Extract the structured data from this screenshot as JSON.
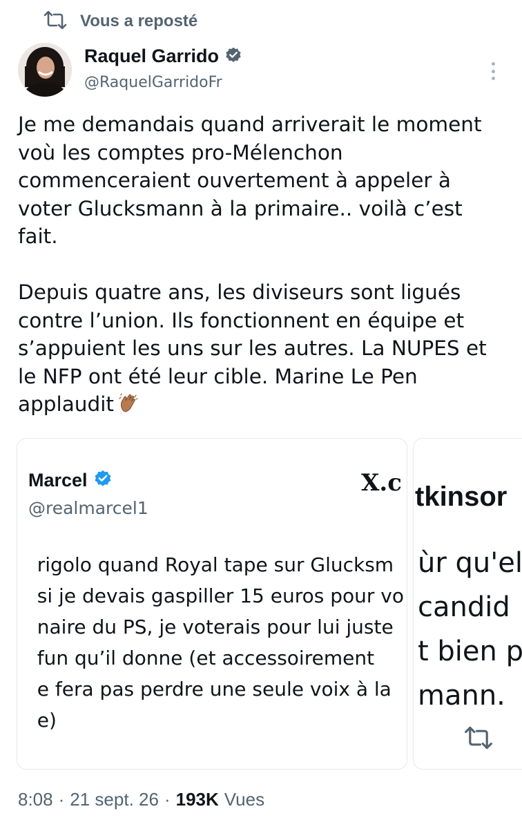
{
  "repost": {
    "label": "Vous a reposté",
    "icon": "repost-icon"
  },
  "author": {
    "name": "Raquel Garrido",
    "handle": "@RaquelGarridoFr",
    "verified": true,
    "verified_color": "#536471",
    "avatar_icon": "profile-photo"
  },
  "tweet": {
    "para1": "Je me demandais quand arriverait le moment\nvoù les comptes pro-Mélenchon\ncommenceraient ouvertement à appeler à\nvoter Glucksmann à la primaire.. voilà c’est\nfait.",
    "para2": "Depuis quatre ans, les diviseurs sont ligués\ncontre l’union.  Ils fonctionnent en équipe et\ns’appuient les uns sur les autres. La NUPES et\nle NFP ont été leur cible. Marine Le Pen\napplaudit",
    "emoji": "clapping-hands-icon"
  },
  "card1": {
    "name": "Marcel",
    "handle": "@realmarcel1",
    "verified_color": "#1d9bf0",
    "x_logo": "X.c",
    "lines": [
      "rigolo quand Royal tape sur Glucksm",
      "si je devais gaspiller 15 euros pour vo",
      "naire du PS, je voterais pour lui juste",
      "fun qu’il donne (et accessoirement",
      "e fera pas perdre une seule voix à la",
      "e)"
    ]
  },
  "card2": {
    "title": "tkinsor",
    "lines": [
      "ùr qu'ell",
      "candid",
      "t bien p",
      "mann."
    ],
    "icon": "repost-icon"
  },
  "meta": {
    "time": "8:08",
    "date": "21 sept. 26",
    "views_count": "193K",
    "views_label": "Vues"
  },
  "colors": {
    "text": "#0f1419",
    "secondary": "#536471",
    "border": "#e5e8eb",
    "verified_blue": "#1d9bf0"
  }
}
